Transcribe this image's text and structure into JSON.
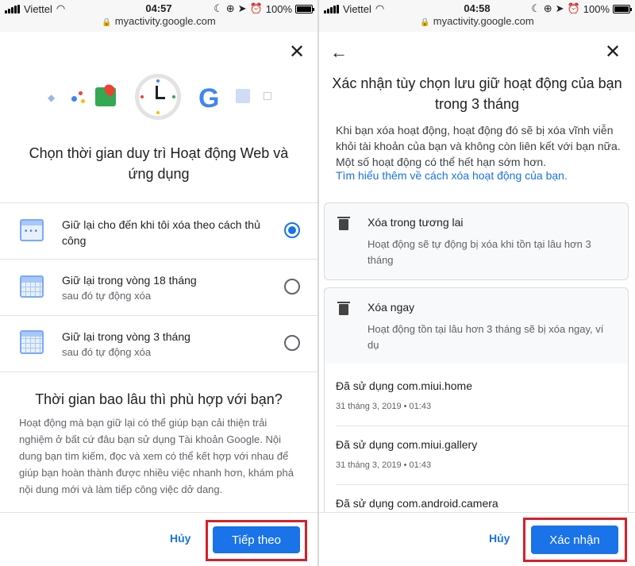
{
  "left": {
    "status": {
      "carrier": "Viettel",
      "time": "04:57",
      "battery": "100%"
    },
    "url": "myactivity.google.com",
    "title": "Chọn thời gian duy trì Hoạt động Web và ứng dụng",
    "options": [
      {
        "label": "Giữ lại cho đến khi tôi xóa theo cách thủ công",
        "sub": "",
        "selected": true
      },
      {
        "label": "Giữ lại trong vòng 18 tháng",
        "sub": "sau đó tự động xóa",
        "selected": false
      },
      {
        "label": "Giữ lại trong vòng 3 tháng",
        "sub": "sau đó tự động xóa",
        "selected": false
      }
    ],
    "how_title": "Thời gian bao lâu thì phù hợp với bạn?",
    "how_body": "Hoạt động mà bạn giữ lại có thể giúp bạn cải thiện trải nghiệm ở bất cứ đâu bạn sử dụng Tài khoản Google. Nội dung bạn tìm kiếm, đọc và xem có thể kết hợp với nhau để giúp bạn hoàn thành được nhiều việc nhanh hơn, khám phá nội dung mới và làm tiếp công việc dở dang.",
    "cancel_label": "Hủy",
    "next_label": "Tiếp theo"
  },
  "right": {
    "status": {
      "carrier": "Viettel",
      "time": "04:58",
      "battery": "100%"
    },
    "url": "myactivity.google.com",
    "title": "Xác nhận tùy chọn lưu giữ hoạt động của bạn trong 3 tháng",
    "info": "Khi bạn xóa hoạt động, hoạt động đó sẽ bị xóa vĩnh viễn khỏi tài khoản của bạn và không còn liên kết với bạn nữa. Một số hoạt động có thể hết hạn sớm hơn.",
    "learn_more": "Tìm hiểu thêm về cách xóa hoạt động của bạn.",
    "card_future": {
      "title": "Xóa trong tương lai",
      "desc": "Hoạt động sẽ tự động bị xóa khi tồn tại lâu hơn 3 tháng"
    },
    "card_now": {
      "title": "Xóa ngay",
      "desc": "Hoạt động tồn tại lâu hơn 3 tháng sẽ bị xóa ngay, ví dụ"
    },
    "activities": [
      {
        "title": "Đã sử dụng com.miui.home",
        "time": "31 tháng 3, 2019 • 01:43"
      },
      {
        "title": "Đã sử dụng com.miui.gallery",
        "time": "31 tháng 3, 2019 • 01:43"
      },
      {
        "title": "Đã sử dụng com.android.camera",
        "time": ""
      }
    ],
    "cancel_label": "Hủy",
    "confirm_label": "Xác nhận"
  },
  "colors": {
    "accent": "#1a73e8",
    "highlight": "#d6202b"
  }
}
